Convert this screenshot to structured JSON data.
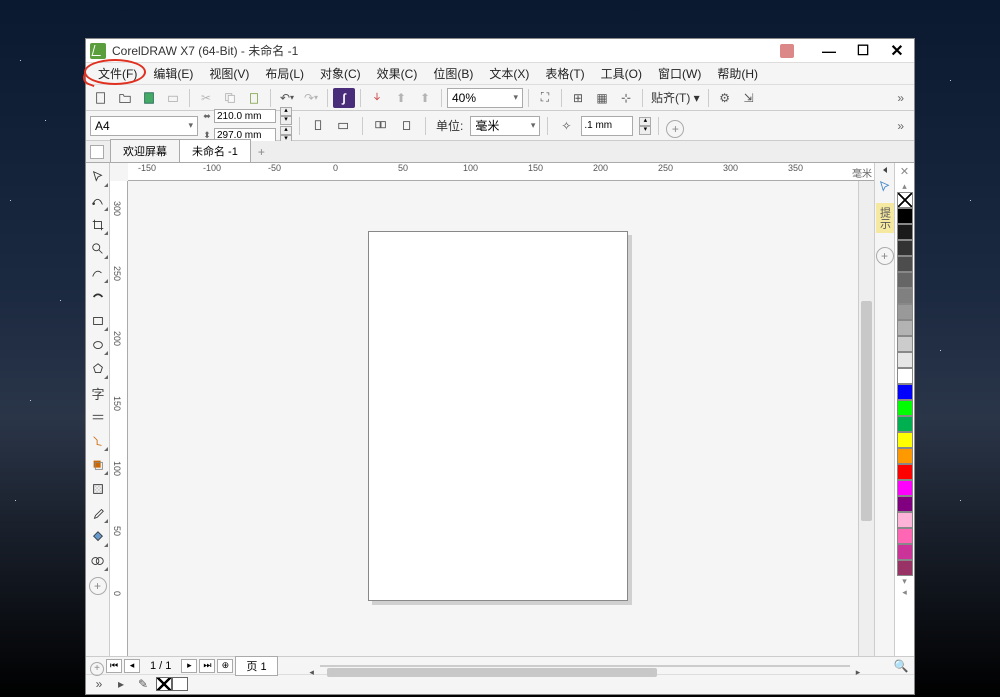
{
  "title": "CorelDRAW X7 (64-Bit) - 未命名 -1",
  "menu": [
    "文件(F)",
    "编辑(E)",
    "视图(V)",
    "布局(L)",
    "对象(C)",
    "效果(C)",
    "位图(B)",
    "文本(X)",
    "表格(T)",
    "工具(O)",
    "窗口(W)",
    "帮助(H)"
  ],
  "toolbar": {
    "zoom": "40%",
    "snap": "贴齐(T)"
  },
  "propbar": {
    "pagesize": "A4",
    "width": "210.0 mm",
    "height": "297.0 mm",
    "units_label": "单位:",
    "units": "毫米",
    "nudge": ".1 mm"
  },
  "tabs": {
    "welcome": "欢迎屏幕",
    "doc": "未命名 -1",
    "add": "+"
  },
  "ruler_unit": "毫米",
  "ruler_ticks": [
    "-150",
    "-100",
    "-50",
    "0",
    "50",
    "100",
    "150",
    "200",
    "250",
    "300",
    "350"
  ],
  "vruler_ticks": [
    "300",
    "250",
    "200",
    "150",
    "100",
    "50",
    "0"
  ],
  "palette": [
    {
      "c": "#000000"
    },
    {
      "c": "#1a1a1a"
    },
    {
      "c": "#333333"
    },
    {
      "c": "#4d4d4d"
    },
    {
      "c": "#666666"
    },
    {
      "c": "#808080"
    },
    {
      "c": "#999999"
    },
    {
      "c": "#b3b3b3"
    },
    {
      "c": "#cccccc"
    },
    {
      "c": "#e6e6e6"
    },
    {
      "c": "#ffffff"
    },
    {
      "c": "#0000ff"
    },
    {
      "c": "#00ff00"
    },
    {
      "c": "#00b050"
    },
    {
      "c": "#ffff00"
    },
    {
      "c": "#ff9900"
    },
    {
      "c": "#ff0000"
    },
    {
      "c": "#ff00ff"
    },
    {
      "c": "#800080"
    },
    {
      "c": "#ffb3d9"
    },
    {
      "c": "#ff66b3"
    },
    {
      "c": "#cc3399"
    },
    {
      "c": "#993366"
    }
  ],
  "hint": "提示",
  "pagenav": {
    "page": "1 / 1",
    "tab": "页 1"
  }
}
